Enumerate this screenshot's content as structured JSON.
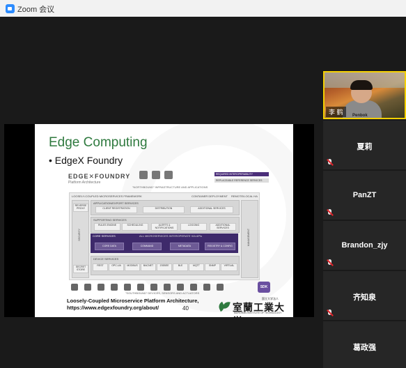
{
  "window": {
    "title": "Zoom 会议"
  },
  "slide": {
    "heading": "Edge Computing",
    "bullet": "• EdgeX Foundry",
    "logo_text": "EDGE✕FOUNDRY",
    "logo_sub": "Platform Architecture",
    "northbound": "\"NORTHBOUND\" INFRASTRUCTURE AND APPLICATIONS",
    "legend": [
      "REQUIRED INTEROPERABILITY FOUNDATION",
      "REPLACEABLE REFERENCE SERVICES"
    ],
    "arch": {
      "title": "LOOSELY-COUPLED MICROSERVICES FRAMEWORK",
      "container": "CONTAINER DEPLOYMENT",
      "remote": "REMOTE/LOCAL HA",
      "app_services": "APPLICATION/EXPORT SERVICES",
      "app_boxes": [
        "CLIENT REGISTRATION",
        "DISTRIBUTION",
        "ADDITIONAL SERVICES"
      ],
      "supporting": "SUPPORTING SERVICES",
      "supp_boxes": [
        "RULES ENGINE",
        "SCHEDULING",
        "ALERTS & NOTIFICATIONS",
        "LOGGING",
        "ADDITIONAL SERVICES"
      ],
      "core_title": "CORE SERVICES",
      "core_sub": "ALL MICROSERVICES INTEROPERATE VIA APIs",
      "core_boxes": [
        "CORE DATA",
        "COMMAND",
        "METADATA",
        "REGISTRY & CONFIG"
      ],
      "device_services": "DEVICE SERVICES",
      "device_boxes": [
        "REST",
        "OPC-UA",
        "MODBUS",
        "BACNET",
        "ZIGBEE",
        "BLE",
        "MQTT",
        "SNMP",
        "VIRTUAL"
      ],
      "left_side": [
        "REVERSE PROXY",
        "SECRET STORE"
      ],
      "left_vertical": "SECURITY",
      "right_vertical": "MANAGEMENT",
      "southbound": "\"SOUTHBOUND\" DEVICES, SENSORS AND ACTUATORS"
    },
    "sdk": "SDK",
    "caption_line1": "Loosely-Coupled Microservice Platform Architecture,",
    "caption_line2": "https://www.edgexfoundry.org/about/",
    "page_number": "40",
    "university_small": "国立大学法人",
    "university_jp": "室蘭工業大学",
    "university_en": "MURORAN INSTITUTE OF TECHNOLOGY"
  },
  "participants": {
    "active": {
      "name": "李 鹤",
      "shirt_text": "Penbok"
    },
    "list": [
      {
        "name": "夏莉"
      },
      {
        "name": "PanZT"
      },
      {
        "name": "Brandon_zjy"
      },
      {
        "name": "齐知泉"
      },
      {
        "name": "葛政强"
      }
    ]
  },
  "colors": {
    "accent": "#f5d000",
    "slide_heading": "#2f7a3f",
    "core_purple": "#3e2a6b",
    "muted_red": "#e0242b"
  }
}
